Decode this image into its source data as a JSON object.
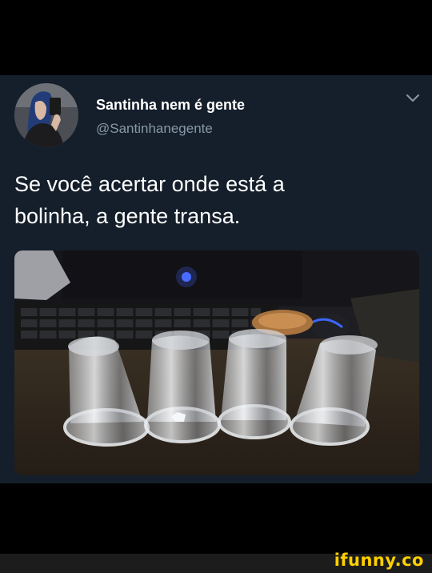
{
  "tweet": {
    "display_name": "Santinha nem é gente",
    "handle": "@Santinhanegente",
    "text_line1": "Se você acertar onde está a",
    "text_line2": "bolinha, a gente transa."
  },
  "icons": {
    "menu": "chevron-down-icon"
  },
  "colors": {
    "card_background": "#151f2b",
    "name": "#ffffff",
    "handle": "#8899a6",
    "watermark": "#ffd000"
  },
  "footer": {
    "watermark": "ifunny.co"
  }
}
